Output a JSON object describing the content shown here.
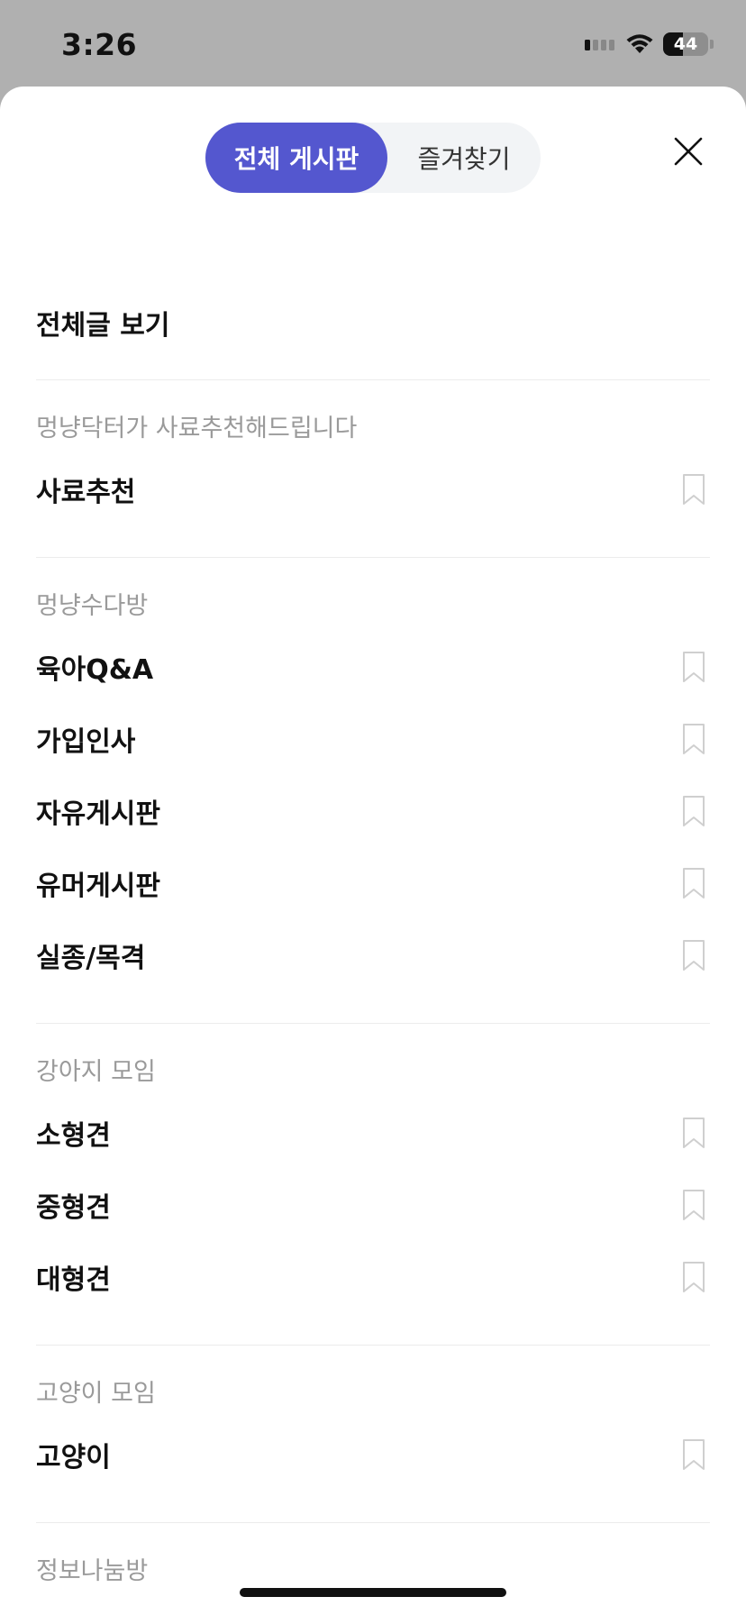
{
  "status_bar": {
    "time": "3:26",
    "battery_percent": "44"
  },
  "tabs": {
    "all_boards": "전체 게시판",
    "favorites": "즐겨찾기",
    "selected": "all_boards"
  },
  "view_all": "전체글 보기",
  "sections": [
    {
      "title": "멍냥닥터가 사료추천해드립니다",
      "items": [
        "사료추천"
      ]
    },
    {
      "title": "멍냥수다방",
      "items": [
        "육아Q&A",
        "가입인사",
        "자유게시판",
        "유머게시판",
        "실종/목격"
      ]
    },
    {
      "title": "강아지 모임",
      "items": [
        "소형견",
        "중형견",
        "대형견"
      ]
    },
    {
      "title": "고양이 모임",
      "items": [
        "고양이"
      ]
    },
    {
      "title": "정보나눔방",
      "items": []
    }
  ],
  "colors": {
    "accent": "#5457cf",
    "status_bar_bg": "#b0b0b0",
    "section_title": "#9a9a9a"
  }
}
